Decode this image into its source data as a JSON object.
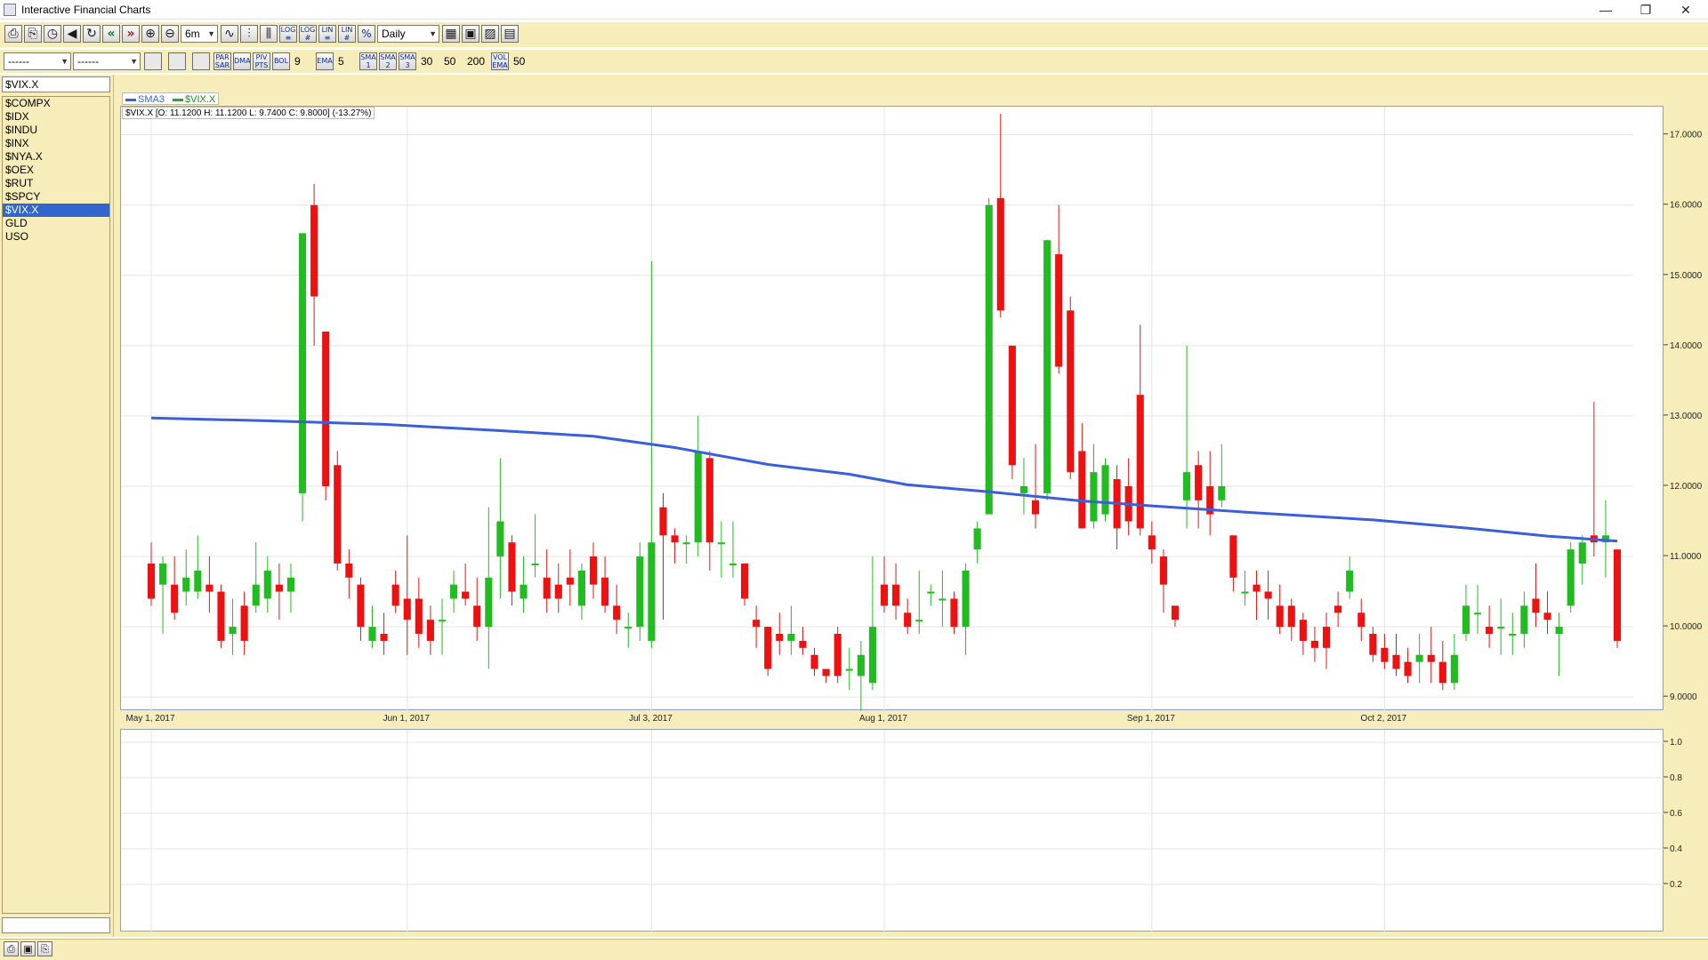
{
  "window": {
    "title": "Interactive Financial Charts",
    "minimize": "—",
    "restore": "❐",
    "close": "✕"
  },
  "toolbar1": {
    "period": "6m",
    "interval": "Daily",
    "btn_log1": "LOG ≡",
    "btn_log2": "LOG #",
    "btn_lin1": "LIN ≡",
    "btn_lin2": "LIN #",
    "btn_pct": "%"
  },
  "toolbar2": {
    "dropdown1": "------",
    "dropdown2": "------",
    "par_sar": "PAR SAR",
    "dma": "DMA",
    "piv_pts": "PIV PTS",
    "bol": "BOL",
    "bol_value": "9",
    "ema": "EMA",
    "ema_value": "5",
    "sma1": "SMA 1",
    "sma2": "SMA 2",
    "sma3": "SMA 3",
    "sma_value1": "30",
    "sma_value2": "50",
    "sma_value3": "200",
    "vol_ema": "VOL EMA",
    "vol_value": "50"
  },
  "sidebar": {
    "symbol_input": "$VIX.X",
    "symbols": [
      "$COMPX",
      "$IDX",
      "$INDU",
      "$INX",
      "$NYA.X",
      "$OEX",
      "$RUT",
      "$SPCY",
      "$VIX.X",
      "GLD",
      "USO"
    ],
    "selected": "$VIX.X"
  },
  "legend": {
    "sma_label": "SMA3",
    "series_label": "$VIX.X",
    "sma_color": "#3a5fd8",
    "series_color": "#22aa22"
  },
  "ohlc_readout": "$VIX.X [O: 11.1200  H: 11.1200  L: 9.7400  C: 9.8000] (-13.27%)",
  "colors": {
    "up": "#22bb22",
    "down": "#ee1111",
    "sma": "#3a5fd8",
    "frame": "#f7edba"
  },
  "chart_data": {
    "type": "candlestick",
    "symbol": "$VIX.X",
    "interval": "Daily",
    "ylim": [
      8.8,
      17.4
    ],
    "y_ticks": [
      "9.0000",
      "10.0000",
      "11.0000",
      "12.0000",
      "13.0000",
      "14.0000",
      "15.0000",
      "16.0000",
      "17.0000"
    ],
    "x_tick_labels": [
      {
        "label": "May 1, 2017",
        "index": 0
      },
      {
        "label": "Jun 1, 2017",
        "index": 22
      },
      {
        "label": "Jul 3, 2017",
        "index": 43
      },
      {
        "label": "Aug 1, 2017",
        "index": 63
      },
      {
        "label": "Sep 1, 2017",
        "index": 86
      },
      {
        "label": "Oct 2, 2017",
        "index": 106
      }
    ],
    "candles": [
      [
        10.9,
        10.4,
        11.2,
        10.3
      ],
      [
        10.6,
        10.9,
        11.0,
        9.9
      ],
      [
        10.6,
        10.2,
        11.0,
        10.1
      ],
      [
        10.5,
        10.7,
        11.1,
        10.3
      ],
      [
        10.5,
        10.8,
        11.3,
        10.4
      ],
      [
        10.6,
        10.5,
        11.0,
        10.2
      ],
      [
        10.5,
        9.8,
        10.6,
        9.7
      ],
      [
        9.9,
        10.0,
        10.4,
        9.6
      ],
      [
        10.3,
        9.8,
        10.5,
        9.6
      ],
      [
        10.3,
        10.6,
        11.2,
        10.2
      ],
      [
        10.4,
        10.8,
        11.0,
        10.2
      ],
      [
        10.6,
        10.5,
        10.9,
        10.1
      ],
      [
        10.5,
        10.7,
        10.9,
        10.2
      ],
      [
        11.9,
        15.6,
        15.6,
        11.5
      ],
      [
        16.0,
        14.7,
        16.3,
        14.0
      ],
      [
        14.2,
        12.0,
        14.2,
        11.8
      ],
      [
        12.3,
        10.9,
        12.5,
        10.8
      ],
      [
        10.9,
        10.7,
        11.1,
        10.4
      ],
      [
        10.6,
        10.0,
        10.7,
        9.8
      ],
      [
        9.8,
        10.0,
        10.3,
        9.7
      ],
      [
        9.9,
        9.8,
        10.2,
        9.6
      ],
      [
        10.6,
        10.3,
        10.8,
        10.2
      ],
      [
        10.4,
        10.1,
        11.3,
        9.6
      ],
      [
        10.4,
        9.9,
        10.7,
        9.7
      ],
      [
        10.1,
        9.8,
        10.3,
        9.6
      ],
      [
        10.1,
        10.1,
        10.4,
        9.6
      ],
      [
        10.4,
        10.6,
        10.8,
        10.2
      ],
      [
        10.5,
        10.4,
        10.9,
        10.3
      ],
      [
        10.3,
        10.0,
        10.7,
        9.8
      ],
      [
        10.0,
        10.7,
        11.7,
        9.4
      ],
      [
        11.0,
        11.5,
        12.4,
        10.4
      ],
      [
        11.2,
        10.5,
        11.3,
        10.3
      ],
      [
        10.4,
        10.6,
        11.0,
        10.2
      ],
      [
        10.9,
        10.9,
        11.6,
        10.7
      ],
      [
        10.7,
        10.4,
        11.1,
        10.2
      ],
      [
        10.6,
        10.4,
        10.9,
        10.2
      ],
      [
        10.7,
        10.6,
        11.1,
        10.3
      ],
      [
        10.3,
        10.8,
        10.9,
        10.1
      ],
      [
        11.0,
        10.6,
        11.2,
        10.4
      ],
      [
        10.7,
        10.3,
        11.0,
        10.2
      ],
      [
        10.3,
        10.1,
        10.6,
        9.9
      ],
      [
        10.0,
        10.0,
        10.2,
        9.7
      ],
      [
        10.0,
        11.0,
        11.2,
        9.8
      ],
      [
        9.8,
        11.2,
        15.2,
        9.7
      ],
      [
        11.7,
        11.3,
        11.9,
        10.1
      ],
      [
        11.3,
        11.2,
        11.4,
        10.9
      ],
      [
        11.2,
        11.2,
        11.3,
        10.9
      ],
      [
        11.2,
        12.5,
        13.0,
        11.0
      ],
      [
        12.4,
        11.2,
        12.5,
        10.8
      ],
      [
        11.2,
        11.2,
        11.5,
        10.7
      ],
      [
        10.9,
        10.9,
        11.5,
        10.7
      ],
      [
        10.9,
        10.4,
        10.9,
        10.3
      ],
      [
        10.1,
        10.0,
        10.3,
        9.7
      ],
      [
        10.0,
        9.4,
        10.0,
        9.3
      ],
      [
        9.9,
        9.8,
        10.2,
        9.6
      ],
      [
        9.8,
        9.9,
        10.3,
        9.6
      ],
      [
        9.8,
        9.7,
        10.0,
        9.6
      ],
      [
        9.6,
        9.4,
        9.7,
        9.3
      ],
      [
        9.4,
        9.3,
        9.4,
        9.2
      ],
      [
        9.9,
        9.3,
        10.0,
        9.2
      ],
      [
        9.4,
        9.4,
        9.7,
        9.1
      ],
      [
        9.3,
        9.6,
        9.8,
        8.8
      ],
      [
        9.2,
        10.0,
        11.0,
        9.1
      ],
      [
        10.6,
        10.3,
        11.0,
        10.2
      ],
      [
        10.6,
        10.3,
        10.9,
        10.1
      ],
      [
        10.2,
        10.0,
        10.4,
        9.9
      ],
      [
        10.1,
        10.1,
        10.8,
        9.9
      ],
      [
        10.5,
        10.5,
        10.6,
        10.3
      ],
      [
        10.4,
        10.4,
        10.8,
        10.0
      ],
      [
        10.4,
        10.0,
        10.5,
        9.9
      ],
      [
        10.0,
        10.8,
        10.9,
        9.6
      ],
      [
        11.1,
        11.4,
        11.5,
        10.9
      ],
      [
        11.6,
        16.0,
        16.1,
        11.6
      ],
      [
        16.1,
        14.5,
        17.3,
        14.4
      ],
      [
        14.0,
        12.3,
        14.0,
        12.1
      ],
      [
        11.9,
        12.0,
        12.4,
        11.6
      ],
      [
        11.8,
        11.6,
        12.6,
        11.4
      ],
      [
        11.9,
        15.5,
        15.5,
        11.8
      ],
      [
        15.3,
        13.7,
        16.0,
        13.6
      ],
      [
        14.5,
        12.2,
        14.7,
        12.1
      ],
      [
        12.5,
        11.4,
        12.9,
        11.4
      ],
      [
        11.5,
        12.2,
        12.6,
        11.4
      ],
      [
        11.6,
        12.3,
        12.4,
        11.5
      ],
      [
        12.1,
        11.4,
        12.3,
        11.1
      ],
      [
        12.0,
        11.5,
        12.4,
        11.3
      ],
      [
        13.3,
        11.4,
        14.3,
        11.3
      ],
      [
        11.3,
        11.1,
        11.5,
        10.9
      ],
      [
        11.0,
        10.6,
        11.1,
        10.2
      ],
      [
        10.3,
        10.1,
        10.3,
        10.0
      ],
      [
        11.8,
        12.2,
        14.0,
        11.4
      ],
      [
        12.3,
        11.8,
        12.5,
        11.4
      ],
      [
        12.0,
        11.6,
        12.5,
        11.3
      ],
      [
        11.8,
        12.0,
        12.6,
        11.7
      ],
      [
        11.3,
        10.7,
        11.3,
        10.5
      ],
      [
        10.5,
        10.5,
        10.8,
        10.3
      ],
      [
        10.6,
        10.5,
        10.8,
        10.1
      ],
      [
        10.5,
        10.4,
        10.8,
        10.1
      ],
      [
        10.3,
        10.0,
        10.6,
        9.9
      ],
      [
        10.3,
        10.0,
        10.4,
        9.8
      ],
      [
        10.1,
        9.8,
        10.2,
        9.6
      ],
      [
        9.8,
        9.7,
        10.0,
        9.5
      ],
      [
        10.0,
        9.7,
        10.2,
        9.4
      ],
      [
        10.3,
        10.2,
        10.5,
        10.0
      ],
      [
        10.5,
        10.8,
        11.0,
        10.4
      ],
      [
        10.2,
        10.0,
        10.4,
        9.8
      ],
      [
        9.9,
        9.6,
        10.0,
        9.5
      ],
      [
        9.7,
        9.5,
        9.9,
        9.4
      ],
      [
        9.6,
        9.4,
        9.9,
        9.3
      ],
      [
        9.5,
        9.3,
        9.7,
        9.2
      ],
      [
        9.5,
        9.6,
        9.9,
        9.2
      ],
      [
        9.6,
        9.5,
        10.0,
        9.2
      ],
      [
        9.5,
        9.2,
        9.8,
        9.1
      ],
      [
        9.2,
        9.6,
        9.9,
        9.1
      ],
      [
        9.9,
        10.3,
        10.6,
        9.8
      ],
      [
        10.2,
        10.2,
        10.6,
        9.9
      ],
      [
        10.0,
        9.9,
        10.3,
        9.7
      ],
      [
        10.0,
        10.0,
        10.4,
        9.6
      ],
      [
        9.9,
        9.9,
        10.2,
        9.6
      ],
      [
        9.9,
        10.3,
        10.5,
        9.7
      ],
      [
        10.4,
        10.2,
        10.9,
        10.0
      ],
      [
        10.2,
        10.1,
        10.5,
        9.9
      ],
      [
        9.9,
        10.0,
        10.2,
        9.3
      ],
      [
        10.3,
        11.1,
        11.2,
        10.2
      ],
      [
        10.9,
        11.2,
        11.3,
        10.6
      ],
      [
        11.3,
        11.2,
        13.2,
        11.0
      ],
      [
        11.2,
        11.3,
        11.8,
        10.7
      ],
      [
        11.1,
        9.8,
        11.1,
        9.7
      ]
    ],
    "sma_line": [
      [
        0,
        12.97
      ],
      [
        10,
        12.93
      ],
      [
        20,
        12.88
      ],
      [
        30,
        12.79
      ],
      [
        38,
        12.71
      ],
      [
        45,
        12.55
      ],
      [
        53,
        12.31
      ],
      [
        60,
        12.17
      ],
      [
        65,
        12.02
      ],
      [
        72,
        11.92
      ],
      [
        80,
        11.79
      ],
      [
        86,
        11.72
      ],
      [
        95,
        11.62
      ],
      [
        105,
        11.52
      ],
      [
        114,
        11.39
      ],
      [
        120,
        11.29
      ],
      [
        126,
        11.22
      ]
    ]
  },
  "sub_chart": {
    "y_ticks": [
      "1.0",
      "0.8",
      "0.6",
      "0.4",
      "0.2"
    ]
  }
}
